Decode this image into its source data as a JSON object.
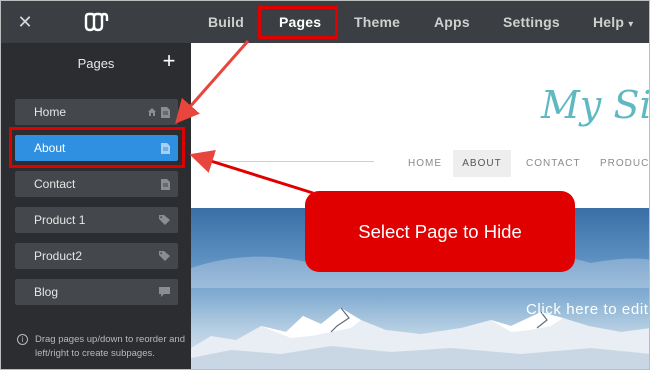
{
  "topbar": {
    "nav": [
      "Build",
      "Pages",
      "Theme",
      "Apps",
      "Settings",
      "Help"
    ],
    "active": "Pages",
    "help_caret": "▾"
  },
  "sidebar": {
    "title": "Pages",
    "add_label": "+",
    "items": [
      {
        "label": "Home",
        "icons": [
          "home-icon",
          "page-icon"
        ]
      },
      {
        "label": "About",
        "icons": [
          "page-icon"
        ],
        "selected": true
      },
      {
        "label": "Contact",
        "icons": [
          "page-icon"
        ]
      },
      {
        "label": "Product 1",
        "icons": [
          "tag-icon"
        ]
      },
      {
        "label": "Product2",
        "icons": [
          "tag-icon"
        ]
      },
      {
        "label": "Blog",
        "icons": [
          "comment-icon"
        ]
      }
    ],
    "hint": "Drag pages up/down to reorder and left/right to create subpages."
  },
  "preview": {
    "site_title": "My Site",
    "nav": [
      "HOME",
      "ABOUT",
      "CONTACT",
      "PRODUCTS"
    ],
    "active_nav": "ABOUT",
    "hero_cta": "Click here to edit"
  },
  "annotation": {
    "callout": "Select Page to Hide",
    "color": "#e00000"
  },
  "colors": {
    "topbar": "#3b3e42",
    "sidebar": "#2b2d30",
    "item": "#44474b",
    "selected": "#2f8fe0",
    "site_title": "#5fb9c2"
  }
}
